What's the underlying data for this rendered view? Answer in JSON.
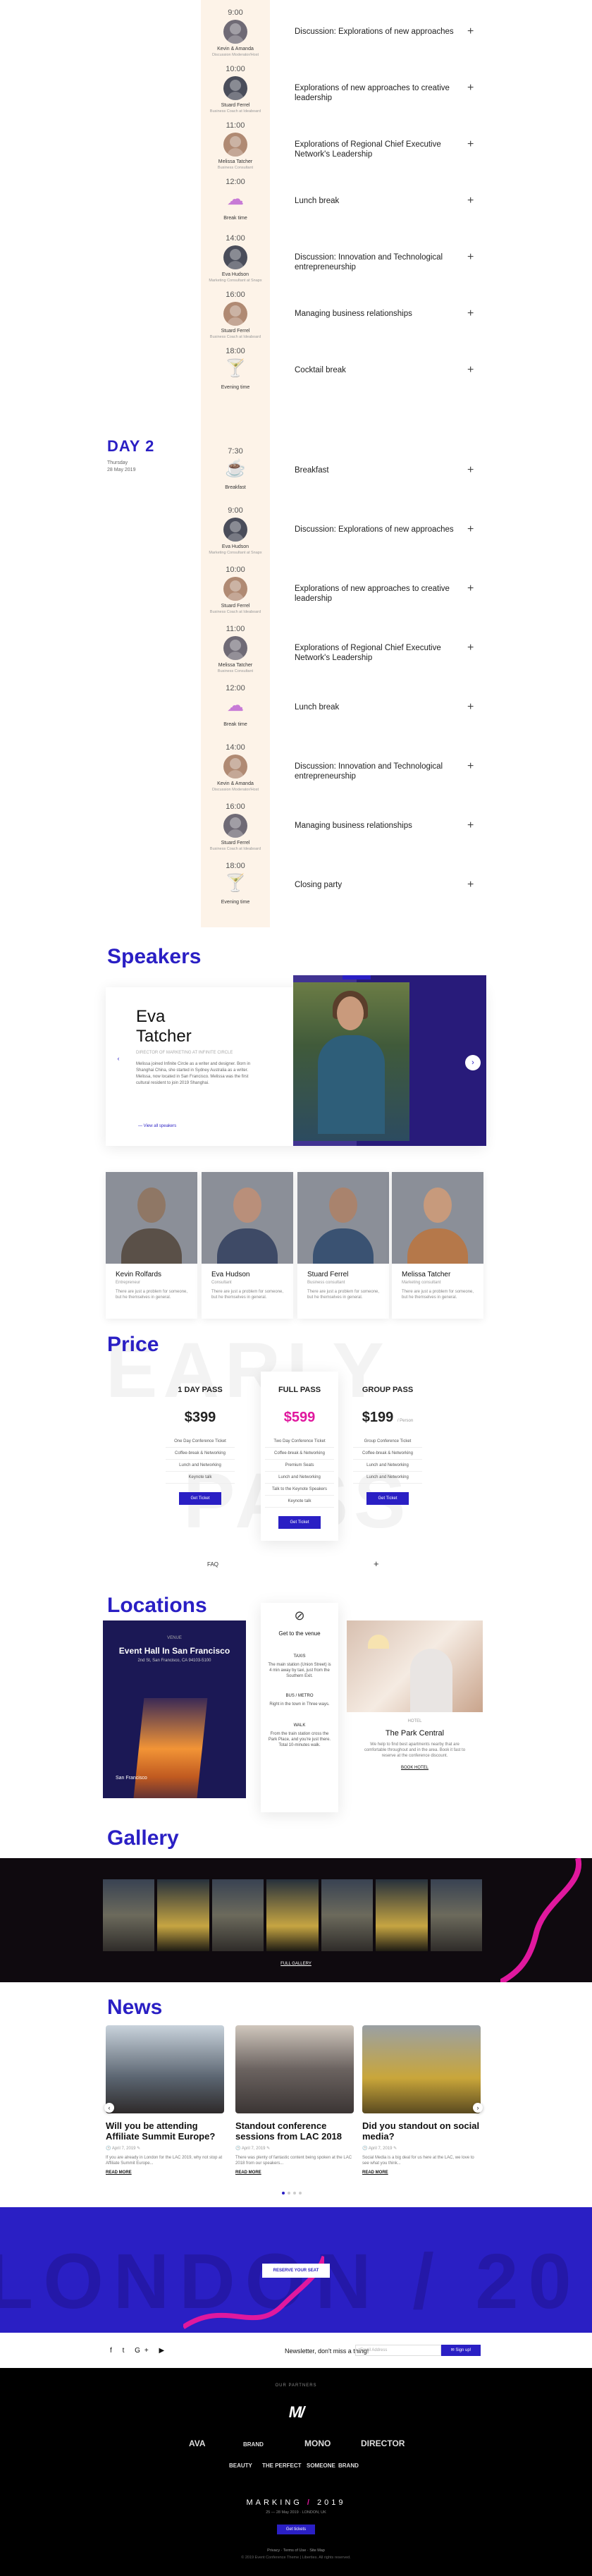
{
  "schedule": {
    "day1_rows": [
      {
        "time": "9:00",
        "speaker": "Kevin & Amanda",
        "role": "Discussion Moderator/Host",
        "title": "Discussion: Explorations of new approaches"
      },
      {
        "time": "10:00",
        "speaker": "Stuard Ferrel",
        "role": "Business Coach at Ideaboard",
        "title": "Explorations of new approaches to creative leadership"
      },
      {
        "time": "11:00",
        "speaker": "Melissa Tatcher",
        "role": "Business Consultant",
        "title": "Explorations of Regional Chief Executive Network's Leadership"
      },
      {
        "time": "12:00",
        "speaker": "Break time",
        "role": "",
        "title": "Lunch break",
        "icon": "☁"
      },
      {
        "time": "14:00",
        "speaker": "Eva Hudson",
        "role": "Marketing Consultant at Snapx",
        "title": "Discussion: Innovation and Technological entrepreneurship"
      },
      {
        "time": "16:00",
        "speaker": "Stuard Ferrel",
        "role": "Business Coach at Ideaboard",
        "title": "Managing business relationships"
      },
      {
        "time": "18:00",
        "speaker": "Evening time",
        "role": "",
        "title": "Cocktail break",
        "icon": "🍸"
      }
    ],
    "day2": {
      "label": "DAY 2",
      "date_line1": "Thursday",
      "date_line2": "28 May 2019"
    },
    "day2_rows": [
      {
        "time": "7:30",
        "speaker": "Breakfast",
        "role": "",
        "title": "Breakfast",
        "icon": "☕"
      },
      {
        "time": "9:00",
        "speaker": "Eva Hudson",
        "role": "Marketing Consultant at Snapx",
        "title": "Discussion: Explorations of new approaches"
      },
      {
        "time": "10:00",
        "speaker": "Stuard Ferrel",
        "role": "Business Coach at Ideaboard",
        "title": "Explorations of new approaches to creative leadership"
      },
      {
        "time": "11:00",
        "speaker": "Melissa Tatcher",
        "role": "Business Consultant",
        "title": "Explorations of Regional Chief Executive Network's Leadership"
      },
      {
        "time": "12:00",
        "speaker": "Break time",
        "role": "",
        "title": "Lunch break",
        "icon": "☁"
      },
      {
        "time": "14:00",
        "speaker": "Kevin & Amanda",
        "role": "Discussion Moderator/Host",
        "title": "Discussion: Innovation and Technological entrepreneurship"
      },
      {
        "time": "16:00",
        "speaker": "Stuard Ferrel",
        "role": "Business Coach at Ideaboard",
        "title": "Managing business relationships"
      },
      {
        "time": "18:00",
        "speaker": "Evening time",
        "role": "",
        "title": "Closing party",
        "icon": "🍸"
      }
    ]
  },
  "speakers": {
    "heading": "Speakers",
    "featured": {
      "first": "Eva",
      "last": "Tatcher",
      "role": "DIRECTOR OF MARKETING AT INFINITE CIRCLE",
      "bio": "Melissa joined Infinite Circle as a writer and designer. Born in Shanghai China, she started in Sydney Australia as a writer. Melissa, now located in San Francisco. Melissa was the first cultural resident to join 2019 Shanghai.",
      "link": "View all speakers"
    },
    "cards": [
      {
        "name": "Kevin Rolfards",
        "role": "Entrepreneur",
        "text": "There are just a problem for someone, but he themselves in general."
      },
      {
        "name": "Eva Hudson",
        "role": "Consultant",
        "text": "There are just a problem for someone, but he themselves in general."
      },
      {
        "name": "Stuard Ferrel",
        "role": "Business consultant",
        "text": "There are just a problem for someone, but he themselves in general."
      },
      {
        "name": "Melissa Tatcher",
        "role": "Marketing consultant",
        "text": "There are just a problem for someone, but he themselves in general."
      }
    ]
  },
  "price": {
    "heading": "Price",
    "bg_word1": "EARLY",
    "bg_word2": "PASS",
    "plans": [
      {
        "name": "1 DAY PASS",
        "price": "$399",
        "features": [
          "One Day Conference Ticket",
          "Coffee-break & Networking",
          "Lunch and Networking",
          "Keynote talk"
        ],
        "button": "Get Ticket"
      },
      {
        "name": "FULL PASS",
        "price": "$599",
        "features": [
          "Two Day Conference Ticket",
          "Coffee-break & Networking",
          "Premium Seats",
          "Lunch and Networking",
          "Talk to the Keynote Speakers",
          "Keynote talk"
        ],
        "button": "Get Ticket"
      },
      {
        "name": "GROUP PASS",
        "price": "$199",
        "price_note": "/ Person",
        "features": [
          "Group Conference Ticket",
          "Coffee-break & Networking",
          "Lunch and Networking",
          "Lunch and Networking"
        ],
        "button": "Get Ticket"
      }
    ],
    "faq": "FAQ",
    "faq_icon": "+"
  },
  "locations": {
    "heading": "Locations",
    "venue": {
      "tag": "VENUE",
      "name": "Event Hall In San Francisco",
      "addr": "2nd St, San Francisco, CA 94103-5100",
      "city": "San Francisco"
    },
    "getting": {
      "title": "Get to the venue",
      "taxi_h": "TAXIS",
      "taxi": "The main station (Union Street) is 4 min away by taxi, just from the Southern Exit.",
      "bus_h": "BUS / METRO",
      "bus": "Right in the town in Three ways.",
      "walk_h": "WALK",
      "walk": "From the train station cross the Park Place, and you're just there. Total 10-minutes walk."
    },
    "hotel": {
      "tag": "HOTEL",
      "name": "The Park Central",
      "text": "We help to find best apartments nearby that are comfortable throughout and in the area. Book it fast to reserve at the conference discount.",
      "link": "BOOK HOTEL"
    }
  },
  "gallery": {
    "heading": "Gallery",
    "more": "FULL GALLERY"
  },
  "news": {
    "heading": "News",
    "items": [
      {
        "title": "Will you be attending Affiliate Summit Europe?",
        "meta": "April 7, 2019",
        "excerpt": "If you are already in London for the LAC 2019, why not stop at Affiliate Summit Europe...",
        "more": "READ MORE"
      },
      {
        "title": "Standout conference sessions from LAC 2018",
        "meta": "April 7, 2019",
        "excerpt": "There was plenty of fantastic content being spoken at the LAC 2018 from our speakers...",
        "more": "READ MORE"
      },
      {
        "title": "Did you standout on social media?",
        "meta": "April 7, 2019",
        "excerpt": "Social Media is a big deal for us here at the LAC, we love to see what you think...",
        "more": "READ MORE"
      }
    ]
  },
  "cta": {
    "bg": "LONDON / 20",
    "button": "RESERVE YOUR SEAT"
  },
  "newsletter": {
    "text": "Newsletter, don't miss a thing!",
    "placeholder": "Email Address",
    "button": "Sign up!"
  },
  "social": [
    "f",
    "t",
    "G+",
    "▶"
  ],
  "footer": {
    "sponsors_label": "OUR PARTNERS",
    "logo": "M/",
    "sponsors": [
      "AVA",
      "BRAND",
      "MONO",
      "DIRECTOR",
      "BEAUTY",
      "THE PERFECT",
      "SOMEONE",
      "BRAND"
    ],
    "year_left": "MARKING",
    "year_right": "2019",
    "address": "25 — 28 May 2019 · LONDON, UK",
    "tickets": "Get tickets",
    "links": "Privacy · Terms of Use · Site Map",
    "copyright": "© 2019 Event Conference Theme | Liberties. All rights reserved."
  },
  "colors": {
    "accent": "#2a1fc4",
    "pink": "#e0189e",
    "timeline": "#fdf3e8"
  }
}
